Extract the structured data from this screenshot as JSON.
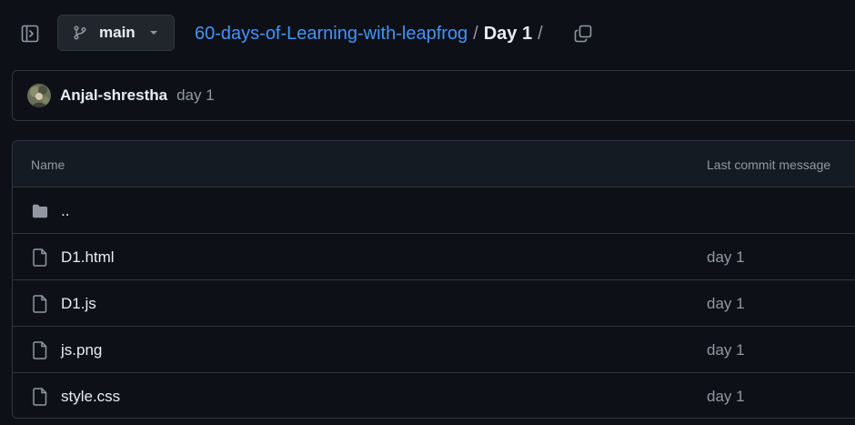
{
  "nav": {
    "branch": {
      "label": "main",
      "icon": "git-branch-icon"
    },
    "breadcrumb": {
      "repo": "60-days-of-Learning-with-leapfrog",
      "separator": "/",
      "current": "Day 1",
      "trailing_separator": "/"
    }
  },
  "latest_commit": {
    "author": "Anjal-shrestha",
    "message": "day 1"
  },
  "files": {
    "columns": {
      "name": "Name",
      "last_commit": "Last commit message"
    },
    "rows": [
      {
        "name": "..",
        "type": "folder",
        "commit": ""
      },
      {
        "name": "D1.html",
        "type": "file",
        "commit": "day 1"
      },
      {
        "name": "D1.js",
        "type": "file",
        "commit": "day 1"
      },
      {
        "name": "js.png",
        "type": "file",
        "commit": "day 1"
      },
      {
        "name": "style.css",
        "type": "file",
        "commit": "day 1"
      }
    ]
  },
  "colors": {
    "background": "#0d1117",
    "border": "#30363d",
    "link": "#4493f8",
    "muted_text": "#9198a1",
    "primary_text": "#e6edf3"
  }
}
